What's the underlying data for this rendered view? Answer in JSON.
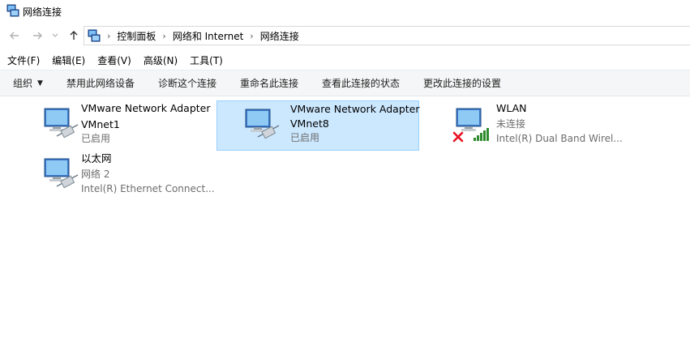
{
  "window": {
    "title": "网络连接"
  },
  "nav": {
    "back_icon": "back-arrow-icon",
    "forward_icon": "forward-arrow-icon",
    "recent_icon": "chevron-down-icon",
    "up_icon": "up-arrow-icon",
    "breadcrumbs": [
      "控制面板",
      "网络和 Internet",
      "网络连接"
    ]
  },
  "menu": {
    "file": "文件(F)",
    "edit": "编辑(E)",
    "view": "查看(V)",
    "advanced": "高级(N)",
    "tools": "工具(T)"
  },
  "commands": {
    "organize": "组织",
    "disable": "禁用此网络设备",
    "diagnose": "诊断这个连接",
    "rename": "重命名此连接",
    "status": "查看此连接的状态",
    "settings": "更改此连接的设置"
  },
  "connections": [
    {
      "name": "VMware Network Adapter",
      "line2": "VMnet1",
      "line3": "已启用",
      "selected": false,
      "icon": "network-adapter-icon"
    },
    {
      "name": "VMware Network Adapter",
      "line2": "VMnet8",
      "line3": "已启用",
      "selected": true,
      "icon": "network-adapter-icon"
    },
    {
      "name": "WLAN",
      "line2": "未连接",
      "line3": "Intel(R) Dual Band Wirel...",
      "selected": false,
      "icon": "wifi-adapter-icon",
      "status_icon": "disconnected-x-icon"
    },
    {
      "name": "以太网",
      "line2": "网络 2",
      "line3": "Intel(R) Ethernet Connect...",
      "selected": false,
      "icon": "ethernet-adapter-icon"
    }
  ],
  "colors": {
    "selection_bg": "#cce8ff",
    "selection_border": "#99d1ff",
    "cmdbar_bg": "#f5f6f7",
    "disconnected": "#e81123",
    "signal": "#2e8b2e"
  }
}
